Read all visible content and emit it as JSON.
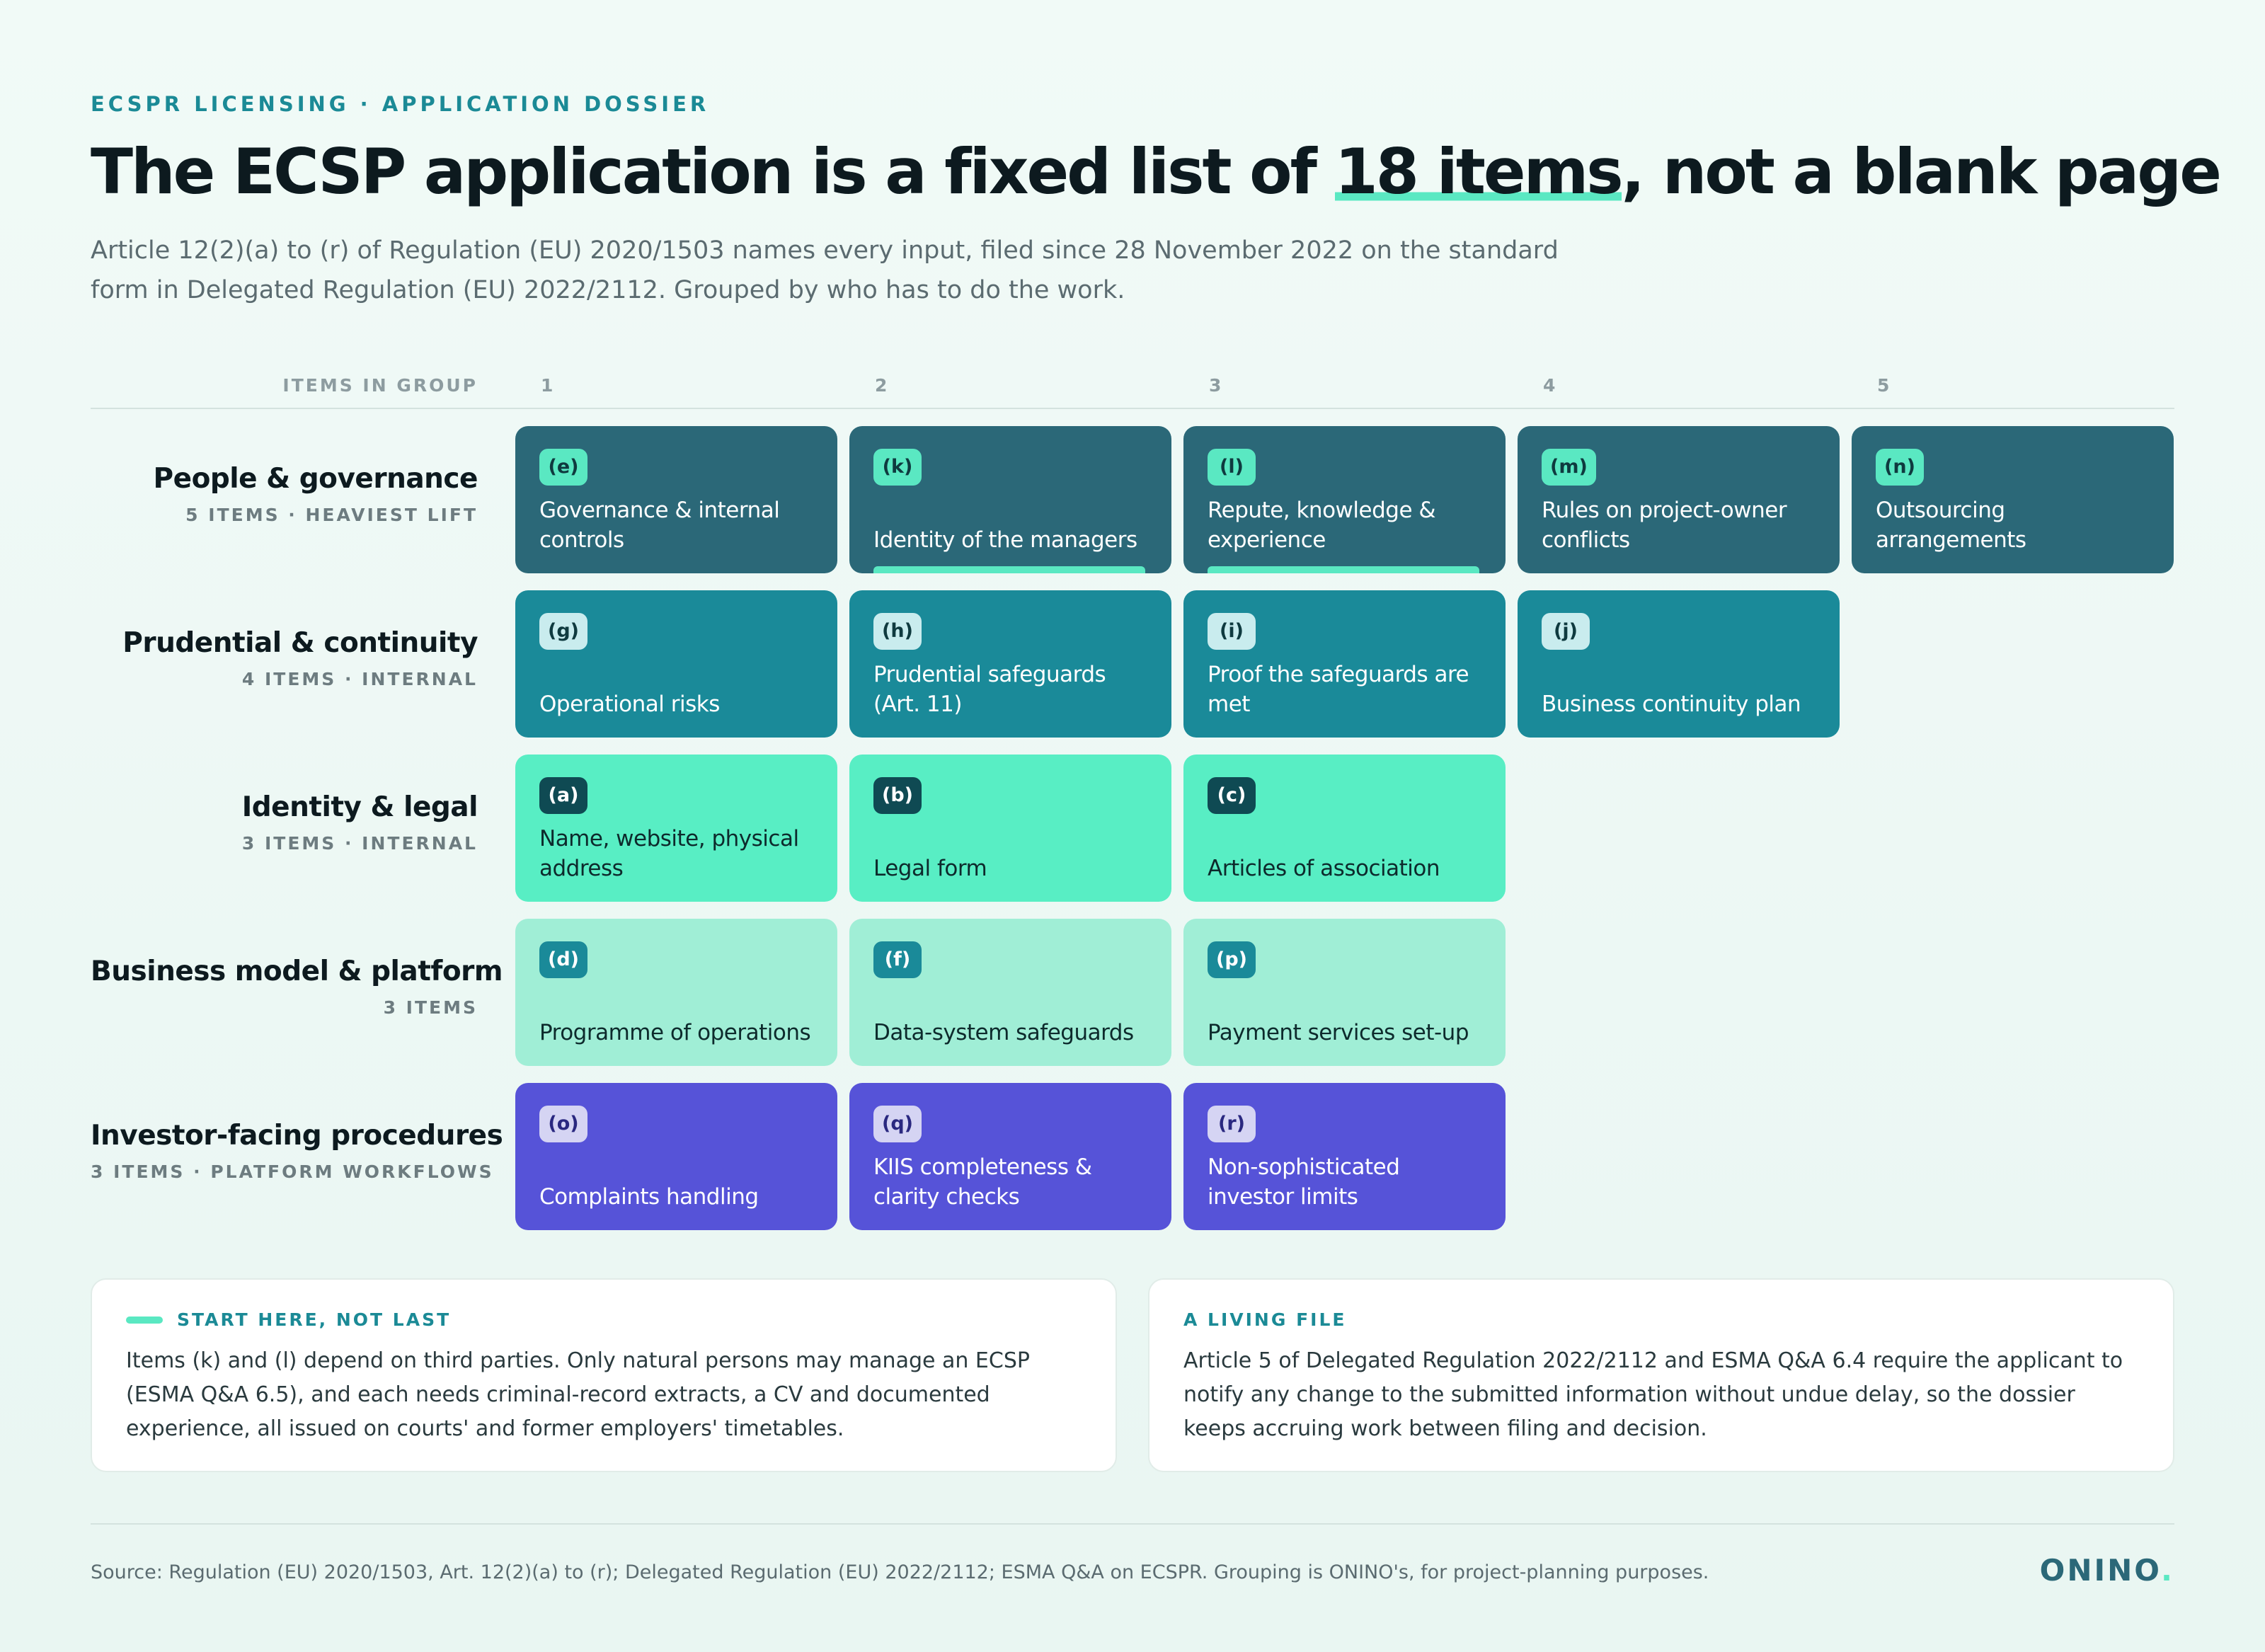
{
  "eyebrow": "ECSPR LICENSING · APPLICATION DOSSIER",
  "headline": {
    "before": "The ECSP application is a fixed list of ",
    "highlight": "18 items",
    "after": ", not a blank page"
  },
  "lede": "Article 12(2)(a) to (r) of Regulation (EU) 2020/1503 names every input, filed since 28 November 2022 on the standard form in Delegated Regulation (EU) 2022/2112. Grouped by who has to do the work.",
  "columns": {
    "label": "ITEMS IN GROUP",
    "numbers": [
      "1",
      "2",
      "3",
      "4",
      "5"
    ]
  },
  "groups": [
    {
      "title": "People & governance",
      "sub": "5 ITEMS · HEAVIEST LIFT",
      "items": [
        {
          "tag": "(e)",
          "label": "Governance & internal controls",
          "third_party": false
        },
        {
          "tag": "(k)",
          "label": "Identity of the managers",
          "third_party": true
        },
        {
          "tag": "(l)",
          "label": "Repute, knowledge & experience",
          "third_party": true
        },
        {
          "tag": "(m)",
          "label": "Rules on project-owner conflicts",
          "third_party": false
        },
        {
          "tag": "(n)",
          "label": "Outsourcing arrangements",
          "third_party": false
        }
      ]
    },
    {
      "title": "Prudential & continuity",
      "sub": "4 ITEMS · INTERNAL",
      "items": [
        {
          "tag": "(g)",
          "label": "Operational risks"
        },
        {
          "tag": "(h)",
          "label": "Prudential safeguards (Art. 11)"
        },
        {
          "tag": "(i)",
          "label": "Proof the safeguards are met"
        },
        {
          "tag": "(j)",
          "label": "Business continuity plan"
        }
      ]
    },
    {
      "title": "Identity & legal",
      "sub": "3 ITEMS · INTERNAL",
      "items": [
        {
          "tag": "(a)",
          "label": "Name, website, physical address"
        },
        {
          "tag": "(b)",
          "label": "Legal form"
        },
        {
          "tag": "(c)",
          "label": "Articles of association"
        }
      ]
    },
    {
      "title": "Business model & platform",
      "sub": "3 ITEMS",
      "items": [
        {
          "tag": "(d)",
          "label": "Programme of operations"
        },
        {
          "tag": "(f)",
          "label": "Data-system safeguards"
        },
        {
          "tag": "(p)",
          "label": "Payment services set-up"
        }
      ]
    },
    {
      "title": "Investor-facing procedures",
      "sub": "3 ITEMS · PLATFORM WORKFLOWS",
      "items": [
        {
          "tag": "(o)",
          "label": "Complaints handling"
        },
        {
          "tag": "(q)",
          "label": "KIIS completeness & clarity checks"
        },
        {
          "tag": "(r)",
          "label": "Non-sophisticated investor limits"
        }
      ]
    }
  ],
  "notes": [
    {
      "heading": "START HERE, NOT LAST",
      "body": "Items (k) and (l) depend on third parties. Only natural persons may manage an ECSP (ESMA Q&A 6.5), and each needs criminal-record extracts, a CV and documented experience, all issued on courts' and former employers' timetables."
    },
    {
      "heading": "A LIVING FILE",
      "body": "Article 5 of Delegated Regulation 2022/2112 and ESMA Q&A 6.4 require the applicant to notify any change to the submitted information without undue delay, so the dossier keeps accruing work between filing and decision."
    }
  ],
  "source": "Source: Regulation (EU) 2020/1503, Art. 12(2)(a) to (r); Delegated Regulation (EU) 2022/2112; ESMA Q&A on ECSPR. Grouping is ONINO's, for project-planning purposes.",
  "logo": {
    "text": "ONINO",
    "dot": "."
  },
  "colors": {
    "accent": "#5ae8c2",
    "people": "#2b6878",
    "prudential": "#1a8a99",
    "identity": "#58eec4",
    "business": "#a0eed6",
    "investor": "#5653d8"
  }
}
